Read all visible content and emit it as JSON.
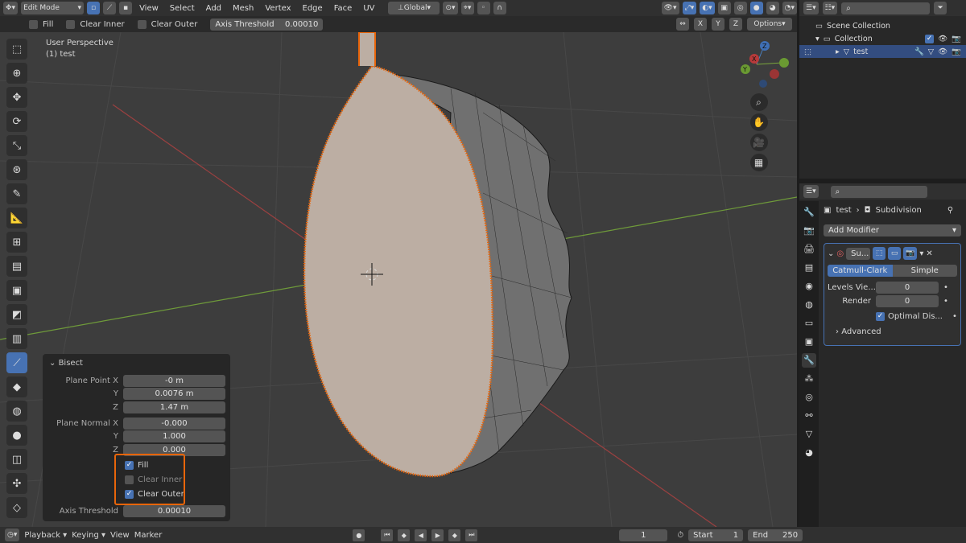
{
  "header": {
    "mode": "Edit Mode",
    "menus": [
      "View",
      "Select",
      "Add",
      "Mesh",
      "Vertex",
      "Edge",
      "Face",
      "UV"
    ],
    "transform_orientation": "Global",
    "axes": [
      "X",
      "Y",
      "Z"
    ],
    "options_label": "Options"
  },
  "tool_settings": {
    "fill_label": "Fill",
    "clear_inner_label": "Clear Inner",
    "clear_outer_label": "Clear Outer",
    "axis_threshold_label": "Axis Threshold",
    "axis_threshold_value": "0.00010"
  },
  "viewport": {
    "perspective_label": "User Perspective",
    "object_label": "(1) test"
  },
  "bisect_panel": {
    "title": "Bisect",
    "plane_point_label": "Plane Point X",
    "plane_point_x": "-0 m",
    "y_label": "Y",
    "plane_point_y": "0.0076 m",
    "z_label": "Z",
    "plane_point_z": "1.47 m",
    "plane_normal_label": "Plane Normal X",
    "plane_normal_x": "-0.000",
    "plane_normal_y": "1.000",
    "plane_normal_z": "0.000",
    "fill_label": "Fill",
    "fill_checked": true,
    "clear_inner_label": "Clear Inner",
    "clear_inner_checked": false,
    "clear_outer_label": "Clear Outer",
    "clear_outer_checked": true,
    "axis_threshold_label": "Axis Threshold",
    "axis_threshold_value": "0.00010"
  },
  "outliner": {
    "scene_collection": "Scene Collection",
    "collection": "Collection",
    "object": "test"
  },
  "properties": {
    "breadcrumb_object": "test",
    "breadcrumb_modifier": "Subdivision",
    "add_modifier": "Add Modifier",
    "modifier_name": "Su...",
    "catmull_clark": "Catmull-Clark",
    "simple": "Simple",
    "levels_viewport_label": "Levels Vie...",
    "levels_viewport_value": "0",
    "render_label": "Render",
    "render_value": "0",
    "optimal_display_label": "Optimal Dis...",
    "advanced_label": "Advanced"
  },
  "timeline": {
    "playback": "Playback",
    "keying": "Keying",
    "view": "View",
    "marker": "Marker",
    "current_frame": "1",
    "start_label": "Start",
    "start_value": "1",
    "end_label": "End",
    "end_value": "250"
  },
  "colors": {
    "accent": "#4772b3",
    "selection_outline": "#e8650a",
    "viewport_bg": "#3d3d3d",
    "panel_bg": "#282828"
  }
}
